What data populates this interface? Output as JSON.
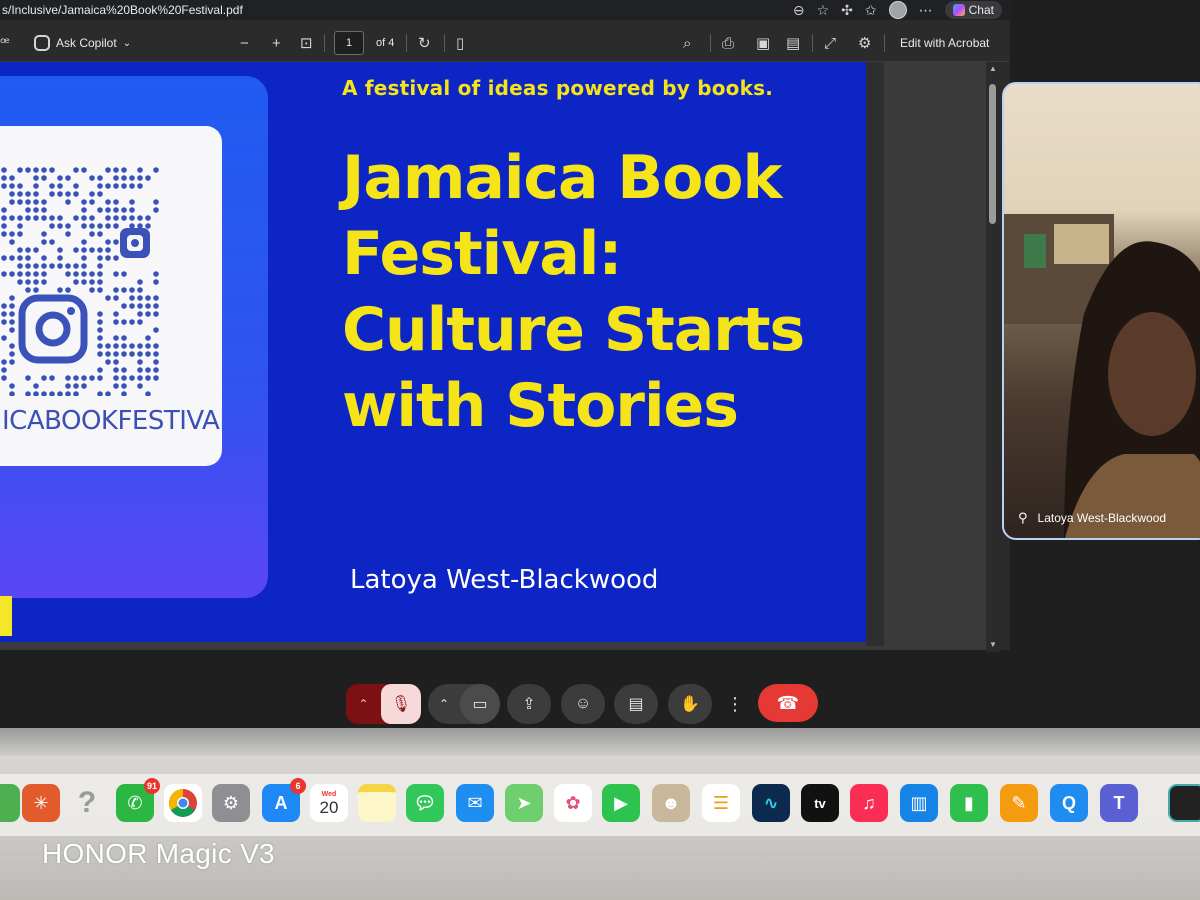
{
  "browser": {
    "url": "s/Inclusive/Jamaica%20Book%20Festival.pdf",
    "chat_label": "Chat"
  },
  "pdf_toolbar": {
    "ask_copilot_label": "Ask Copilot",
    "page_number": "1",
    "page_total": "of 4",
    "edit_label": "Edit with Acrobat"
  },
  "slide": {
    "tagline": "A festival of ideas powered by books.",
    "title_lines": [
      "Jamaica Book",
      "Festival:",
      "Culture Starts",
      "with Stories"
    ],
    "author": "Latoya West-Blackwood",
    "qr_handle": "ICABOOKFESTIVAL"
  },
  "participant": {
    "name": "Latoya West-Blackwood"
  },
  "controls": {
    "mic_state": "muted",
    "items": [
      "mic-options",
      "mic",
      "camera-options",
      "camera",
      "present",
      "emoji",
      "captions",
      "raise-hand",
      "more",
      "leave-call"
    ]
  },
  "dock": {
    "whatsapp_badge": "91",
    "appstore_badge": "6",
    "calendar_day": "Wed",
    "calendar_date": "20"
  },
  "watermark": "HONOR Magic V3",
  "colors": {
    "slide_background": "#0d25c4",
    "slide_heading": "#f4e418",
    "hangup": "#e53935",
    "mic_muted": "#7b1113"
  }
}
